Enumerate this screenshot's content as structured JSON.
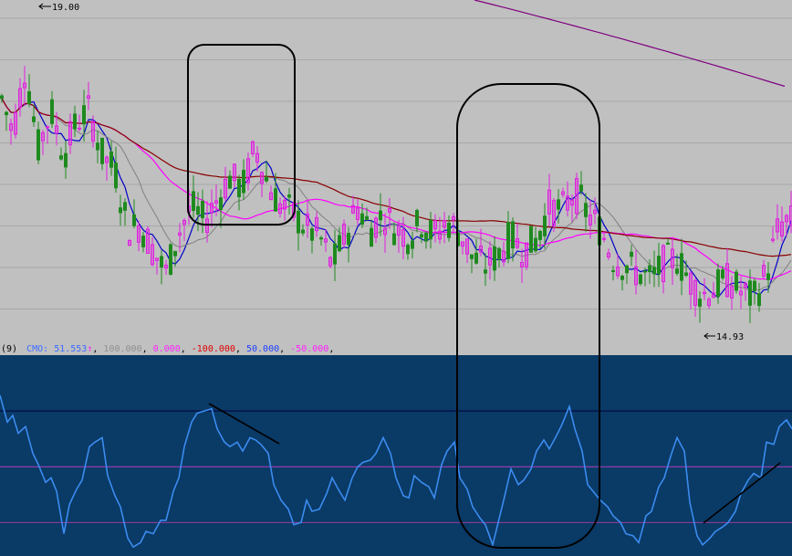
{
  "chart_data": [
    {
      "type": "candlestick",
      "panel": "price",
      "ylim": [
        14.5,
        19.1
      ],
      "grid": true,
      "colors": {
        "background": "#c0c0c0",
        "grid": "#a8a8a8",
        "up_candle": "#e020e0",
        "down_candle": "#1e8a1e",
        "ma_blue": "#0000c8",
        "ma_pink": "#ff00ff",
        "ma_darkred": "#880000",
        "ma_purple": "#800080",
        "ma_gray": "#808080"
      },
      "annotations": {
        "high_label": "19.00",
        "low_label": "14.93"
      },
      "ohlc_close_anchor": [
        [
          0,
          17.85
        ],
        [
          14,
          17.3
        ],
        [
          28,
          18.2
        ],
        [
          42,
          17.1
        ],
        [
          56,
          17.6
        ],
        [
          70,
          17.0
        ],
        [
          84,
          17.45
        ],
        [
          98,
          17.6
        ],
        [
          112,
          17.0
        ],
        [
          126,
          16.8
        ],
        [
          140,
          16.0
        ],
        [
          154,
          16.05
        ],
        [
          168,
          15.7
        ],
        [
          182,
          15.4
        ],
        [
          196,
          15.95
        ],
        [
          210,
          16.3
        ],
        [
          224,
          16.1
        ],
        [
          238,
          16.4
        ],
        [
          252,
          16.7
        ],
        [
          266,
          16.55
        ],
        [
          280,
          17.1
        ],
        [
          294,
          16.6
        ],
        [
          308,
          16.3
        ],
        [
          322,
          16.2
        ],
        [
          336,
          16.0
        ],
        [
          350,
          15.9
        ],
        [
          364,
          15.5
        ],
        [
          378,
          15.9
        ],
        [
          392,
          16.3
        ],
        [
          406,
          16.0
        ],
        [
          420,
          16.2
        ],
        [
          434,
          16.0
        ],
        [
          448,
          15.9
        ],
        [
          462,
          16.1
        ],
        [
          476,
          15.9
        ],
        [
          490,
          16.1
        ],
        [
          504,
          15.95
        ],
        [
          518,
          15.6
        ],
        [
          532,
          15.5
        ],
        [
          546,
          15.65
        ],
        [
          560,
          15.9
        ],
        [
          574,
          15.7
        ],
        [
          588,
          15.85
        ],
        [
          602,
          16.3
        ],
        [
          616,
          16.25
        ],
        [
          630,
          16.5
        ],
        [
          644,
          16.2
        ],
        [
          658,
          16.0
        ],
        [
          672,
          15.6
        ],
        [
          686,
          15.5
        ],
        [
          700,
          15.4
        ],
        [
          714,
          15.3
        ],
        [
          728,
          15.55
        ],
        [
          742,
          15.6
        ],
        [
          756,
          15.3
        ],
        [
          770,
          15.1
        ],
        [
          784,
          15.2
        ],
        [
          798,
          15.3
        ],
        [
          812,
          15.15
        ],
        [
          826,
          15.05
        ],
        [
          840,
          15.4
        ],
        [
          854,
          16.05
        ],
        [
          868,
          16.1
        ]
      ]
    },
    {
      "type": "line",
      "panel": "indicator",
      "title": "(9)",
      "legend": [
        {
          "name": "CMO: 51.553",
          "color": "#3b9cff"
        },
        {
          "name": "100.000",
          "color": "#909090"
        },
        {
          "name": "0.000",
          "color": "#ff40ff"
        },
        {
          "name": "-100.000",
          "color": "#ff3030"
        },
        {
          "name": "50.000",
          "color": "#4060ff"
        },
        {
          "name": "-50.000",
          "color": "#ff40ff"
        }
      ],
      "ylim": [
        -80,
        100
      ],
      "reference_lines": [
        50,
        0,
        -50
      ],
      "colors": {
        "background": "#0a3a66",
        "line": "#3b8cf0"
      },
      "x": [
        0,
        8,
        14,
        20,
        28,
        36,
        42,
        50,
        56,
        62,
        70,
        76,
        84,
        90,
        98,
        104,
        112,
        118,
        126,
        132,
        140,
        146,
        154,
        160,
        168,
        176,
        182,
        190,
        196,
        202,
        210,
        216,
        224,
        232,
        238,
        246,
        252,
        260,
        266,
        274,
        280,
        286,
        294,
        300,
        308,
        316,
        322,
        330,
        336,
        342,
        350,
        358,
        364,
        372,
        378,
        386,
        392,
        398,
        406,
        412,
        420,
        428,
        434,
        442,
        448,
        454,
        462,
        470,
        476,
        484,
        490,
        498,
        504,
        512,
        518,
        526,
        532,
        540,
        546,
        552,
        560,
        568,
        574,
        582,
        588,
        596,
        602,
        610,
        616,
        624,
        630,
        638,
        644,
        652,
        658,
        666,
        672,
        680,
        686,
        694,
        700,
        708,
        714,
        722,
        728,
        736,
        742,
        750,
        756,
        764,
        770,
        778,
        784,
        792,
        798,
        806,
        812,
        820,
        826,
        834,
        840,
        848,
        854,
        862,
        868
      ],
      "values": [
        64,
        40,
        46,
        30,
        36,
        12,
        2,
        -14,
        -10,
        -22,
        -60,
        -34,
        -20,
        -12,
        18,
        22,
        26,
        -8,
        -26,
        -36,
        -64,
        -72,
        -68,
        -58,
        -60,
        -48,
        -48,
        -22,
        -10,
        18,
        40,
        48,
        50,
        52,
        34,
        22,
        18,
        22,
        14,
        26,
        24,
        20,
        12,
        -16,
        -30,
        -38,
        -52,
        -50,
        -30,
        -40,
        -38,
        -24,
        -10,
        -22,
        -30,
        -10,
        0,
        4,
        6,
        12,
        26,
        12,
        -10,
        -26,
        -28,
        -8,
        -14,
        -18,
        -28,
        2,
        14,
        22,
        -10,
        -20,
        -36,
        -46,
        -52,
        -70,
        -50,
        -30,
        -2,
        -16,
        -12,
        -2,
        14,
        24,
        16,
        28,
        38,
        54,
        34,
        14,
        -16,
        -24,
        -30,
        -36,
        -44,
        -50,
        -60,
        -62,
        -68,
        -44,
        -40,
        -18,
        -10,
        12,
        26,
        14,
        -32,
        -62,
        -70,
        -64,
        -58,
        -54,
        -50,
        -40,
        -24,
        -12,
        -6,
        -10,
        22,
        20,
        36,
        42,
        34,
        38,
        56
      ]
    }
  ]
}
